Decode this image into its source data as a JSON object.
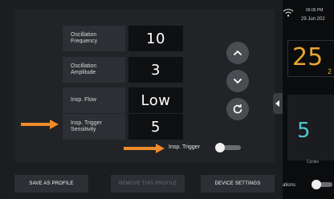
{
  "params": [
    {
      "label": "Oscillation\nFrequency",
      "value": "10"
    },
    {
      "label": "Oscillation\nAmplitude",
      "value": "3"
    },
    {
      "label": "Insp. Flow",
      "value": "Low"
    },
    {
      "label": "Insp. Trigger\nSensitivity",
      "value": "5"
    }
  ],
  "controls": {
    "up_icon": "chevron-up-icon",
    "down_icon": "chevron-down-icon",
    "reset_icon": "refresh-icon"
  },
  "trigger": {
    "label": "Insp. Trigger",
    "state": "off"
  },
  "buttons": {
    "save": "SAVE AS PROFILE",
    "remove": "REMOVE THIS PROFILE",
    "device": "DEVICE SETTINGS"
  },
  "status": {
    "time": "06:06 PM",
    "date": "29 Jun 202"
  },
  "side": {
    "big_value": "25",
    "slash": "2",
    "card_value": "5",
    "card_label": "Cycles",
    "bottom_label": "ations"
  },
  "colors": {
    "accent_orange": "#f08a2a",
    "amber": "#e8a432",
    "cyan": "#4fc7d0"
  }
}
